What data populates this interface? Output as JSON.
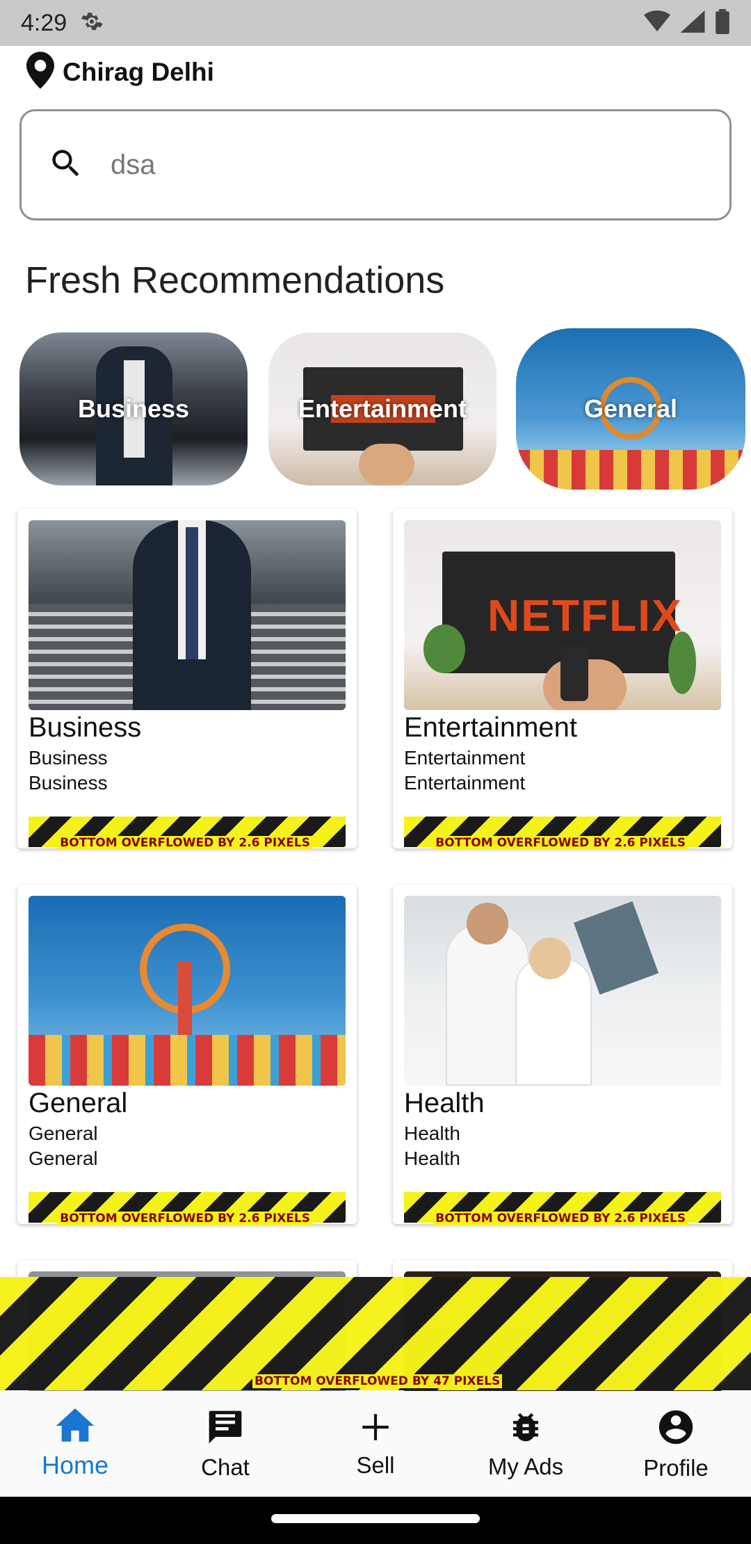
{
  "status_bar": {
    "time": "4:29",
    "icons": [
      "settings-icon",
      "wifi-icon",
      "signal-icon",
      "battery-icon"
    ]
  },
  "location": {
    "label": "Chirag Delhi",
    "icon": "location-pin-icon"
  },
  "search": {
    "value": "dsa",
    "icon": "search-icon"
  },
  "section_title": "Fresh Recommendations",
  "categories": [
    {
      "label": "Business"
    },
    {
      "label": "Entertainment"
    },
    {
      "label": "General"
    }
  ],
  "cards": [
    {
      "title": "Business",
      "line1": "Business",
      "line2": "Business",
      "overflow": "BOTTOM OVERFLOWED BY 2.6 PIXELS"
    },
    {
      "title": "Entertainment",
      "line1": "Entertainment",
      "line2": "Entertainment",
      "overflow": "BOTTOM OVERFLOWED BY 2.6 PIXELS",
      "image_text": "NETFLIX"
    },
    {
      "title": "General",
      "line1": "General",
      "line2": "General",
      "overflow": "BOTTOM OVERFLOWED BY 2.6 PIXELS"
    },
    {
      "title": "Health",
      "line1": "Health",
      "line2": "Health",
      "overflow": "BOTTOM OVERFLOWED BY 2.6 PIXELS"
    }
  ],
  "page_overflow": "BOTTOM OVERFLOWED BY 47 PIXELS",
  "bottom_nav": [
    {
      "label": "Home",
      "icon": "home-icon",
      "active": true
    },
    {
      "label": "Chat",
      "icon": "chat-icon",
      "active": false
    },
    {
      "label": "Sell",
      "icon": "plus-icon",
      "active": false
    },
    {
      "label": "My Ads",
      "icon": "bug-icon",
      "active": false
    },
    {
      "label": "Profile",
      "icon": "account-circle-icon",
      "active": false
    }
  ],
  "colors": {
    "accent": "#1976d2",
    "overflow_yellow": "#f5f21a",
    "overflow_text": "#8a0000",
    "status_bar": "#c9c9c9"
  }
}
